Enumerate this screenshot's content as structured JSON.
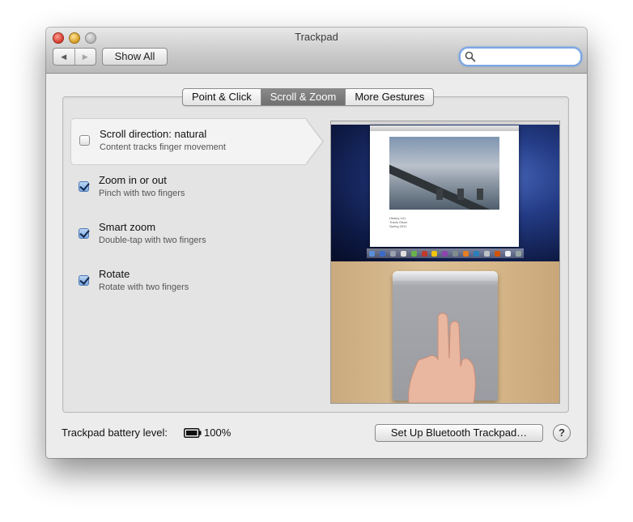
{
  "window": {
    "title": "Trackpad"
  },
  "toolbar": {
    "back_icon": "◀",
    "forward_icon": "▶",
    "show_all_label": "Show All",
    "search_placeholder": ""
  },
  "tabs": [
    {
      "label": "Point & Click",
      "active": false
    },
    {
      "label": "Scroll & Zoom",
      "active": true
    },
    {
      "label": "More Gestures",
      "active": false
    }
  ],
  "options": [
    {
      "title": "Scroll direction: natural",
      "subtitle": "Content tracks finger movement",
      "checked": false,
      "selected": true
    },
    {
      "title": "Zoom in or out",
      "subtitle": "Pinch with two fingers",
      "checked": true,
      "selected": false
    },
    {
      "title": "Smart zoom",
      "subtitle": "Double-tap with two fingers",
      "checked": true,
      "selected": false
    },
    {
      "title": "Rotate",
      "subtitle": "Rotate with two fingers",
      "checked": true,
      "selected": false
    }
  ],
  "preview": {
    "doc_lines": [
      "History 101",
      "Travis Olson",
      "Spring 2011"
    ]
  },
  "footer": {
    "battery_label": "Trackpad battery level:",
    "battery_value": "100%",
    "bluetooth_button": "Set Up Bluetooth Trackpad…",
    "help_label": "?"
  },
  "colors": {
    "accent": "#7aa7e6",
    "active_tab": "#7c7c7c",
    "window_bg": "#ececec"
  }
}
